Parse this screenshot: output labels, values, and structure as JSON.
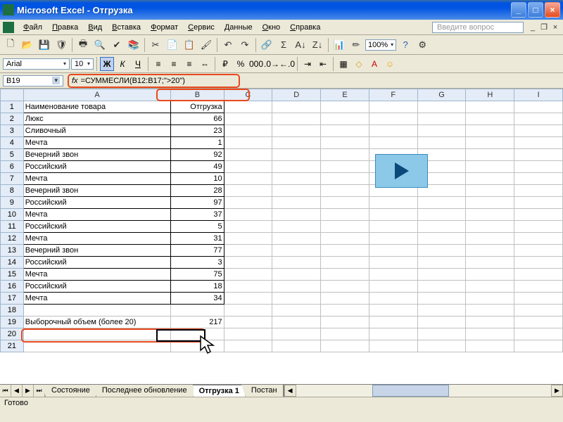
{
  "app": {
    "title": "Microsoft Excel - Отгрузка",
    "help_placeholder": "Введите вопрос"
  },
  "menu": [
    "Файл",
    "Правка",
    "Вид",
    "Вставка",
    "Формат",
    "Сервис",
    "Данные",
    "Окно",
    "Справка"
  ],
  "toolbar": {
    "zoom": "100%"
  },
  "format": {
    "font": "Arial",
    "size": "10"
  },
  "formula": {
    "cell_ref": "B19",
    "formula": "=СУММЕСЛИ(B12:B17;\">20\")",
    "fx_label": "fx"
  },
  "columns": [
    "A",
    "B",
    "C",
    "D",
    "E",
    "F",
    "G",
    "H",
    "I"
  ],
  "headers": {
    "A1": "Наименование товара",
    "B1": "Отгрузка"
  },
  "rows": [
    {
      "n": 2,
      "a": "Люкс",
      "b": "66"
    },
    {
      "n": 3,
      "a": "Сливочный",
      "b": "23"
    },
    {
      "n": 4,
      "a": "Мечта",
      "b": "1"
    },
    {
      "n": 5,
      "a": "Вечерний звон",
      "b": "92"
    },
    {
      "n": 6,
      "a": "Российский",
      "b": "49"
    },
    {
      "n": 7,
      "a": "Мечта",
      "b": "10"
    },
    {
      "n": 8,
      "a": "Вечерний звон",
      "b": "28"
    },
    {
      "n": 9,
      "a": "Российский",
      "b": "97"
    },
    {
      "n": 10,
      "a": "Мечта",
      "b": "37"
    },
    {
      "n": 11,
      "a": "Российский",
      "b": "5"
    },
    {
      "n": 12,
      "a": "Мечта",
      "b": "31"
    },
    {
      "n": 13,
      "a": "Вечерний звон",
      "b": "77"
    },
    {
      "n": 14,
      "a": "Российский",
      "b": "3"
    },
    {
      "n": 15,
      "a": "Мечта",
      "b": "75"
    },
    {
      "n": 16,
      "a": "Российский",
      "b": "18"
    },
    {
      "n": 17,
      "a": "Мечта",
      "b": "34"
    }
  ],
  "summary": {
    "row": 19,
    "label": "Выборочный объем (более 20)",
    "value": "217"
  },
  "empty_rows": [
    18,
    20,
    21
  ],
  "tabs": {
    "items": [
      "Состояние",
      "Последнее обновление",
      "Отгрузка 1",
      "Постан"
    ],
    "active": 2
  },
  "status": "Готово"
}
